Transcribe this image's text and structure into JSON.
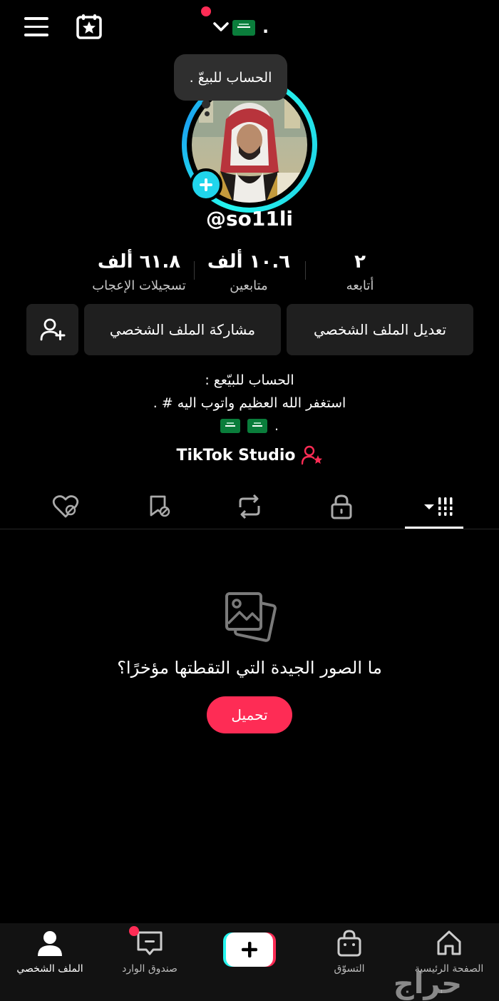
{
  "header": {
    "menu_icon": "hamburger-menu-icon",
    "calendar_icon": "calendar-star-icon",
    "account_suffix": "."
  },
  "tooltip": {
    "text": "الحساب للبيعّ ."
  },
  "profile": {
    "username": "@so11li"
  },
  "stats": {
    "following": {
      "value": "٢",
      "label": "أتابعه"
    },
    "followers": {
      "value": "١٠.٦ ألف",
      "label": "متابعين"
    },
    "likes": {
      "value": "٦١.٨ ألف",
      "label": "تسجيلات الإعجاب"
    }
  },
  "buttons": {
    "edit_profile": "تعديل الملف الشخصي",
    "share_profile": "مشاركة الملف الشخصي"
  },
  "bio": {
    "line1": "الحساب للبيّعع :",
    "line2": "استغفر الله العظيم واتوب اليه # .",
    "line3_dot": "."
  },
  "studio": {
    "label": "TikTok Studio"
  },
  "tabs": [
    "videos",
    "private",
    "reposts",
    "favorites",
    "liked"
  ],
  "empty_state": {
    "title": "ما الصور الجيدة التي التقطتها مؤخرًا؟",
    "upload_label": "تحميل"
  },
  "bottom_nav": {
    "home": "الصفحة الرئيسية",
    "shop": "التسوّق",
    "inbox": "صندوق الوارد",
    "profile": "الملف الشخصي"
  },
  "watermark": "حراج",
  "colors": {
    "accent": "#fe2c55",
    "cyan": "#25f4ee",
    "button_bg": "#1f1f1f"
  }
}
